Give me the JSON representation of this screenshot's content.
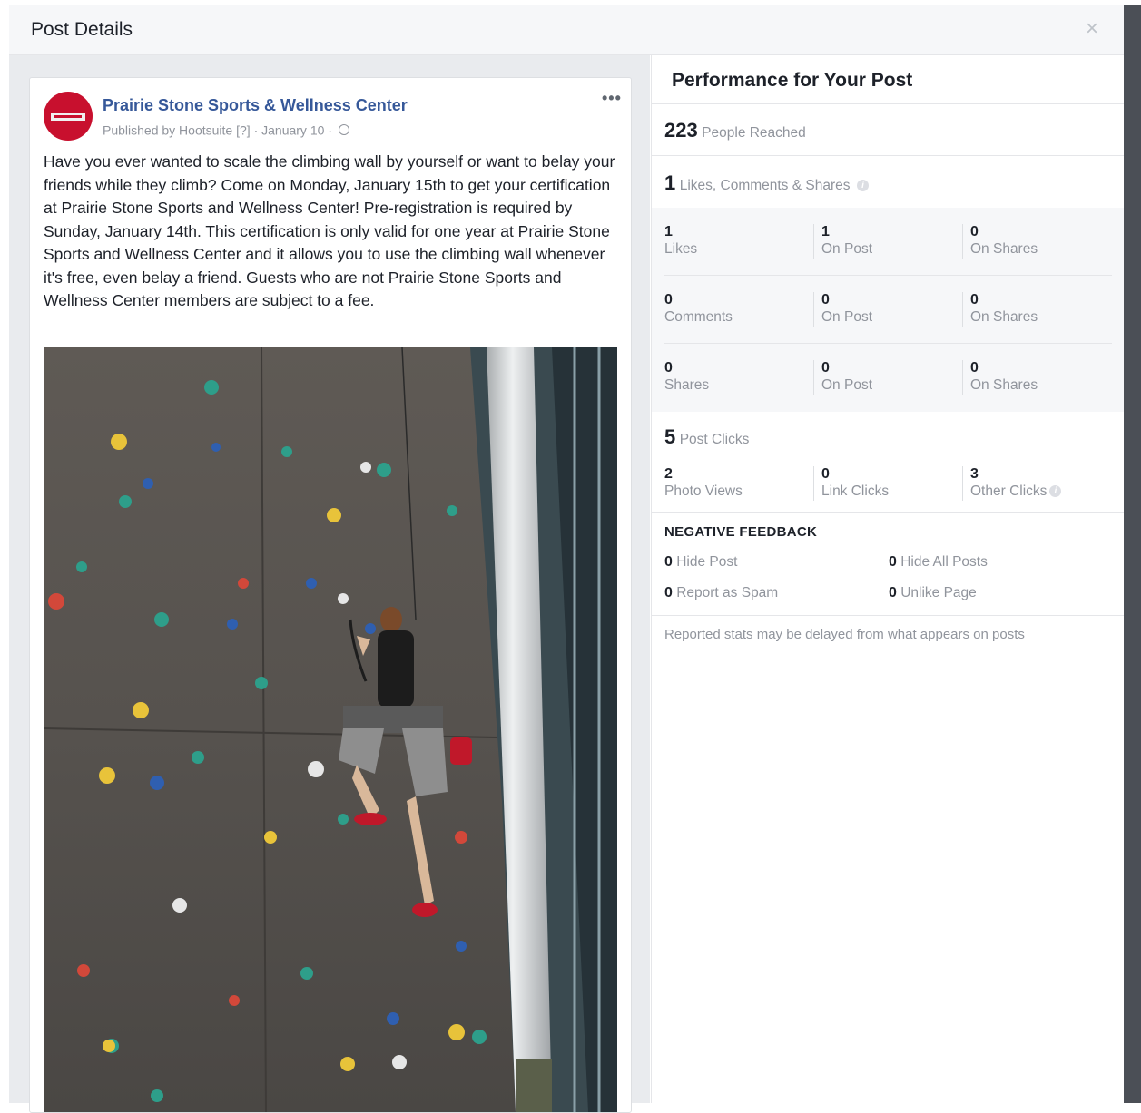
{
  "modal": {
    "title": "Post Details",
    "close_label": "×"
  },
  "post": {
    "page_name": "Prairie Stone Sports & Wellness Center",
    "publisher": "Published by Hootsuite",
    "help_marker": "[?]",
    "separator": "·",
    "date": "January 10",
    "more_label": "•••",
    "text": "Have you ever wanted to scale the climbing wall by yourself or want to belay your friends while they climb? Come on Monday, January 15th to get your certification at Prairie Stone Sports and Wellness Center! Pre-registration is required by Sunday, January 14th. This certification is only valid for one year at Prairie Stone Sports and Wellness Center and it allows you to use the climbing wall whenever it's free, even belay a friend. Guests who are not Prairie Stone Sports and Wellness Center members are subject to a fee."
  },
  "performance": {
    "title": "Performance for Your Post",
    "reach": {
      "value": "223",
      "label": "People Reached"
    },
    "engagement": {
      "value": "1",
      "label": "Likes, Comments & Shares"
    },
    "rows": [
      {
        "cells": [
          {
            "value": "1",
            "label": "Likes"
          },
          {
            "value": "1",
            "label": "On Post"
          },
          {
            "value": "0",
            "label": "On Shares"
          }
        ]
      },
      {
        "cells": [
          {
            "value": "0",
            "label": "Comments"
          },
          {
            "value": "0",
            "label": "On Post"
          },
          {
            "value": "0",
            "label": "On Shares"
          }
        ]
      },
      {
        "cells": [
          {
            "value": "0",
            "label": "Shares"
          },
          {
            "value": "0",
            "label": "On Post"
          },
          {
            "value": "0",
            "label": "On Shares"
          }
        ]
      }
    ],
    "clicks": {
      "value": "5",
      "label": "Post Clicks",
      "cells": [
        {
          "value": "2",
          "label": "Photo Views"
        },
        {
          "value": "0",
          "label": "Link Clicks"
        },
        {
          "value": "3",
          "label": "Other Clicks"
        }
      ]
    },
    "negative": {
      "title": "NEGATIVE FEEDBACK",
      "items": [
        {
          "value": "0",
          "label": "Hide Post"
        },
        {
          "value": "0",
          "label": "Hide All Posts"
        },
        {
          "value": "0",
          "label": "Report as Spam"
        },
        {
          "value": "0",
          "label": "Unlike Page"
        }
      ]
    },
    "footer": "Reported stats may be delayed from what appears on posts"
  },
  "colors": {
    "page_link": "#365899",
    "muted": "#90949c",
    "avatar": "#c8102e"
  },
  "icons": {
    "close": "close-icon",
    "globe": "globe-icon",
    "info": "info-icon",
    "more": "more-options-icon"
  }
}
